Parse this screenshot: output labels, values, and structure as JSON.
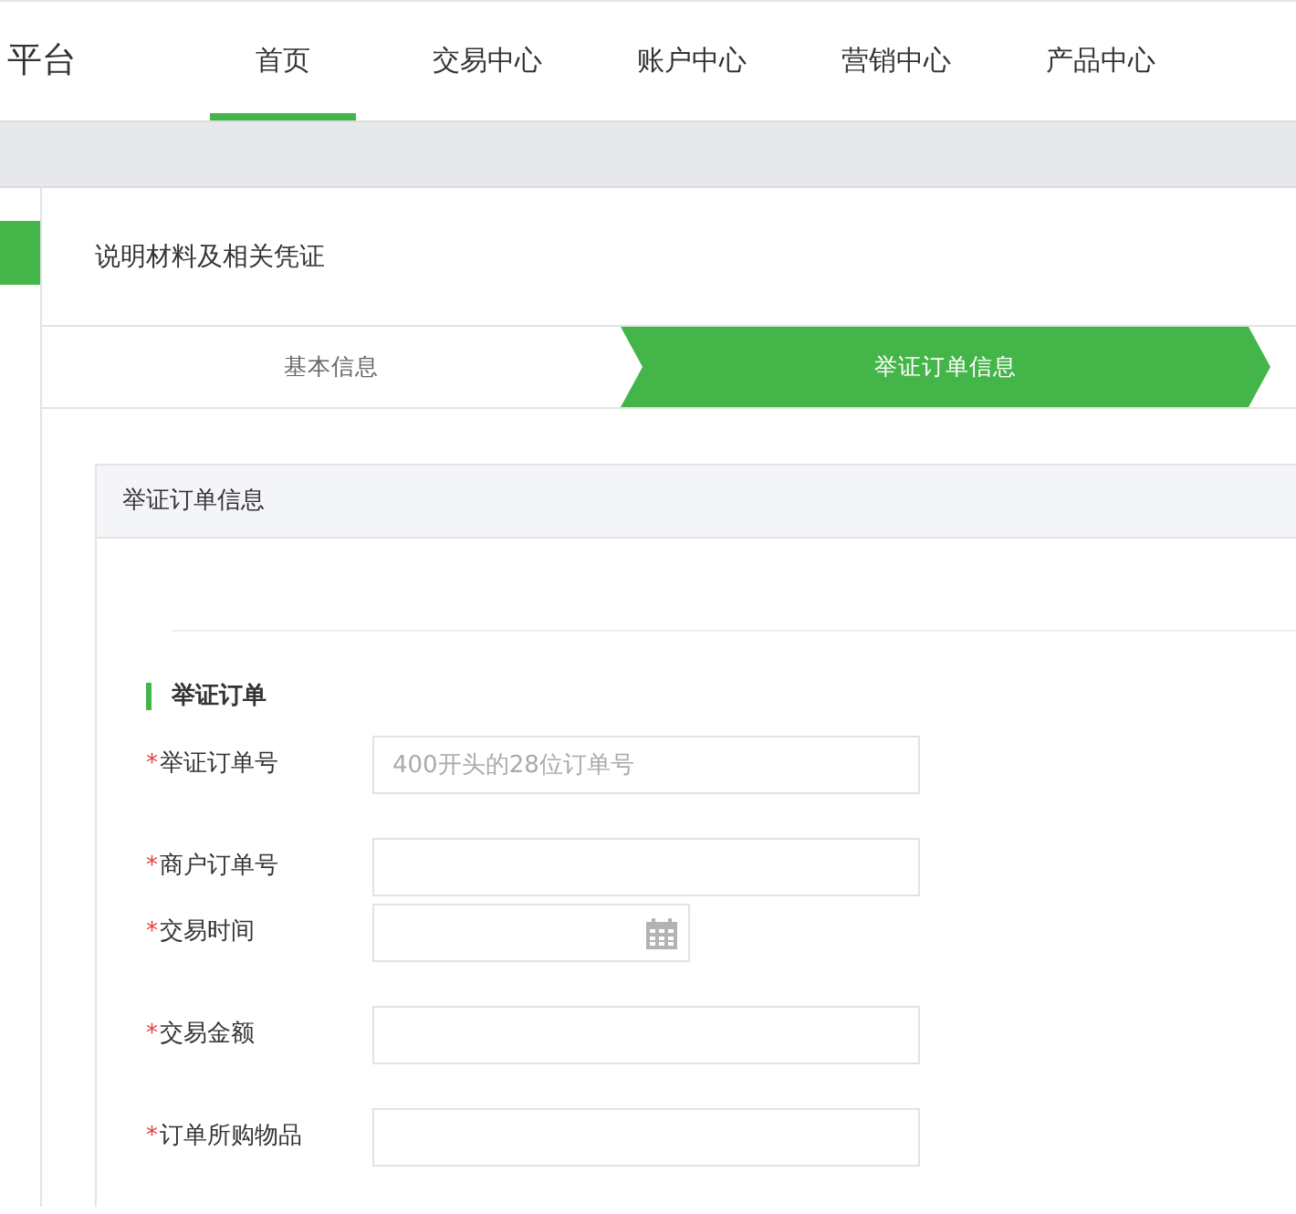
{
  "brand": "平台",
  "nav": [
    {
      "label": "首页",
      "selected": true
    },
    {
      "label": "交易中心",
      "selected": false
    },
    {
      "label": "账户中心",
      "selected": false
    },
    {
      "label": "营销中心",
      "selected": false
    },
    {
      "label": "产品中心",
      "selected": false
    }
  ],
  "page_title": "说明材料及相关凭证",
  "steps": [
    {
      "label": "基本信息",
      "selected": false
    },
    {
      "label": "举证订单信息",
      "selected": true
    }
  ],
  "panel": {
    "title": "举证订单信息",
    "section_title": "举证订单",
    "fields": [
      {
        "kind": "text",
        "required_mark": "*",
        "label": "举证订单号",
        "placeholder": "400开头的28位订单号"
      },
      {
        "kind": "text",
        "required_mark": "*",
        "label": "商户订单号"
      },
      {
        "kind": "date",
        "required_mark": "*",
        "label": "交易时间"
      },
      {
        "kind": "text",
        "required_mark": "*",
        "label": "交易金额"
      },
      {
        "kind": "text",
        "required_mark": "*",
        "label": "订单所购物品"
      }
    ]
  }
}
